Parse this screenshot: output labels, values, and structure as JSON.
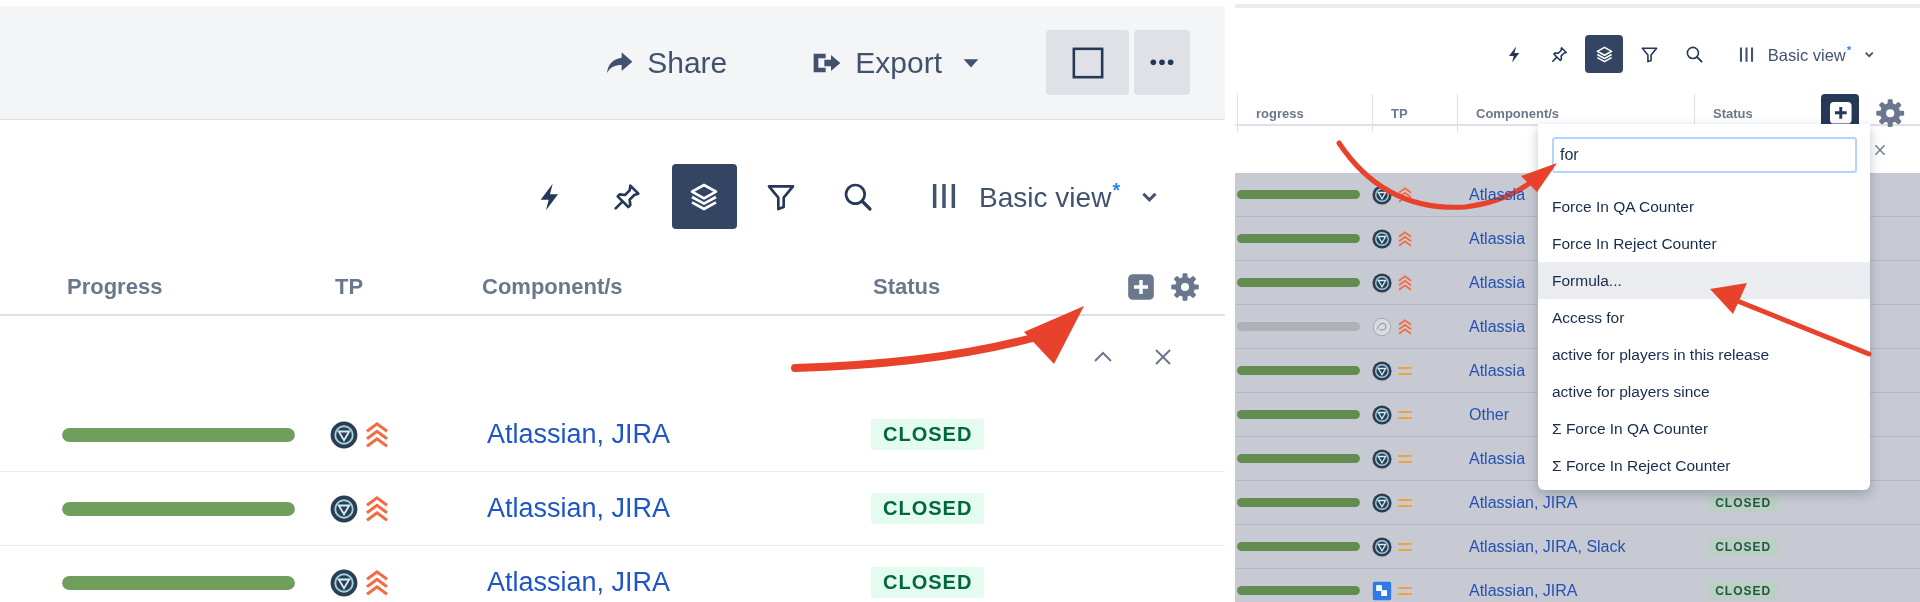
{
  "left_panel": {
    "top_bar": {
      "actions": [
        {
          "kind": "share",
          "label": "Share"
        },
        {
          "kind": "export",
          "label": "Export"
        }
      ]
    },
    "toolbar": {
      "tools": [
        {
          "kind": "bolt",
          "selected": false
        },
        {
          "kind": "pin",
          "selected": false
        },
        {
          "kind": "layers",
          "selected": true
        },
        {
          "kind": "filter",
          "selected": false
        },
        {
          "kind": "search",
          "selected": false
        }
      ],
      "view": {
        "label": "Basic view",
        "mark": "*"
      }
    },
    "columns": [
      "Progress",
      "TP",
      "Component/s",
      "Status"
    ],
    "add_column": {
      "selected": false
    },
    "filter_row": {
      "collapse": true
    },
    "rows": [
      {
        "progress": {
          "level": 1
        },
        "avatar": {
          "kind": "reactor"
        },
        "priority": {
          "kind": "highest"
        },
        "components": "Atlassian, JIRA",
        "status": "CLOSED"
      },
      {
        "progress": {
          "level": 1
        },
        "avatar": {
          "kind": "reactor"
        },
        "priority": {
          "kind": "highest"
        },
        "components": "Atlassian, JIRA",
        "status": "CLOSED"
      },
      {
        "progress": {
          "level": 1
        },
        "avatar": {
          "kind": "reactor"
        },
        "priority": {
          "kind": "highest"
        },
        "components": "Atlassian, JIRA",
        "status": "CLOSED"
      }
    ]
  },
  "right_panel": {
    "toolbar": {
      "tools": [
        {
          "kind": "bolt",
          "selected": false
        },
        {
          "kind": "pin",
          "selected": false
        },
        {
          "kind": "layers",
          "selected": true
        },
        {
          "kind": "filter",
          "selected": false
        },
        {
          "kind": "search",
          "selected": false
        }
      ],
      "view": {
        "label": "Basic view",
        "mark": "*"
      }
    },
    "columns": [
      "rogress",
      "TP",
      "Component/s",
      "Status"
    ],
    "add_column": {
      "selected": true
    },
    "filter_row": {
      "collapse": false
    },
    "rows": [
      {
        "progress": {
          "level": 1
        },
        "avatar": {
          "kind": "reactor"
        },
        "priority": {
          "kind": "highest"
        },
        "components": "Atlassia"
      },
      {
        "progress": {
          "level": 1
        },
        "avatar": {
          "kind": "reactor"
        },
        "priority": {
          "kind": "highest"
        },
        "components": "Atlassia"
      },
      {
        "progress": {
          "level": 1
        },
        "avatar": {
          "kind": "reactor"
        },
        "priority": {
          "kind": "highest"
        },
        "components": "Atlassia"
      },
      {
        "progress": {
          "level": 0
        },
        "avatar": {
          "kind": "sketch"
        },
        "priority": {
          "kind": "highest"
        },
        "components": "Atlassia"
      },
      {
        "progress": {
          "level": 1
        },
        "avatar": {
          "kind": "reactor"
        },
        "priority": {
          "kind": "medium"
        },
        "components": "Atlassia"
      },
      {
        "progress": {
          "level": 1
        },
        "avatar": {
          "kind": "reactor"
        },
        "priority": {
          "kind": "medium"
        },
        "components": "Other"
      },
      {
        "progress": {
          "level": 1
        },
        "avatar": {
          "kind": "reactor"
        },
        "priority": {
          "kind": "medium"
        },
        "components": "Atlassia"
      },
      {
        "progress": {
          "level": 1
        },
        "avatar": {
          "kind": "reactor"
        },
        "priority": {
          "kind": "medium"
        },
        "components": "Atlassian, JIRA",
        "status": "CLOSED"
      },
      {
        "progress": {
          "level": 1
        },
        "avatar": {
          "kind": "reactor"
        },
        "priority": {
          "kind": "medium"
        },
        "components": "Atlassian, JIRA, Slack",
        "status": "CLOSED"
      },
      {
        "progress": {
          "level": 1
        },
        "avatar": {
          "kind": "app"
        },
        "priority": {
          "kind": "medium"
        },
        "components": "Atlassian, JIRA",
        "status": "CLOSED"
      }
    ],
    "dropdown": {
      "query": "for",
      "options": [
        {
          "label": "Force In QA Counter",
          "selected": false
        },
        {
          "label": "Force In Reject Counter",
          "selected": false
        },
        {
          "label": "Formula...",
          "selected": true
        },
        {
          "label": "Access for",
          "selected": false
        },
        {
          "label": "active for players in this release",
          "selected": false
        },
        {
          "label": "active for players since",
          "selected": false
        },
        {
          "label": "Σ Force In QA Counter",
          "selected": false
        },
        {
          "label": "Σ Force In Reject Counter",
          "selected": false
        }
      ]
    }
  }
}
